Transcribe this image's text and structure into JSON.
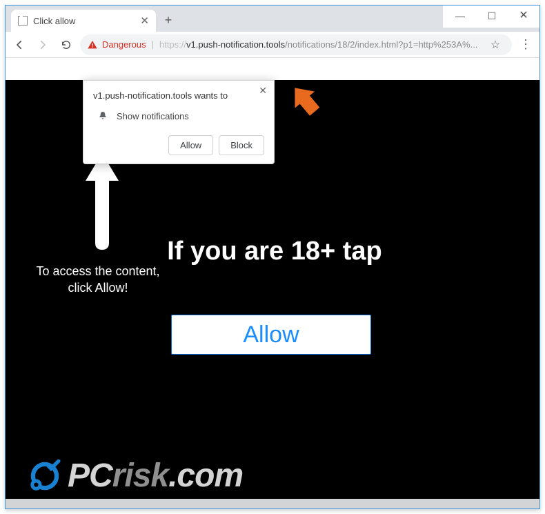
{
  "window": {
    "minimize": "—",
    "maximize": "☐",
    "close": "✕"
  },
  "tab": {
    "title": "Click allow",
    "close": "✕",
    "new": "+"
  },
  "omnibox": {
    "danger_label": "Dangerous",
    "scheme": "https",
    "sep": "://",
    "host": "v1.push-notification.tools",
    "path": "/notifications/18/2/index.html?p1=http%253A%..."
  },
  "toolbar": {
    "star": "☆",
    "menu": "⋮"
  },
  "notif": {
    "origin": "v1.push-notification.tools wants to",
    "message": "Show notifications",
    "allow": "Allow",
    "block": "Block",
    "close": "✕"
  },
  "page": {
    "instruction_line1": "To access the content,",
    "instruction_line2": "click Allow!",
    "headline": "If you are 18+ tap",
    "big_allow": "Allow"
  },
  "watermark": {
    "text1": "PC",
    "text2": "risk",
    "text3": ".com"
  }
}
